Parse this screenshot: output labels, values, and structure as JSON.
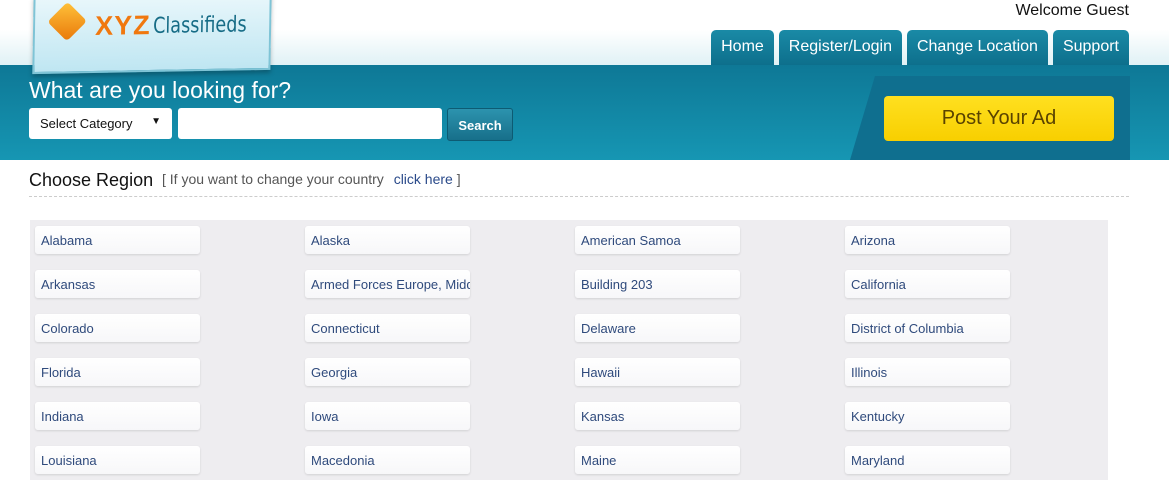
{
  "logo": {
    "text_bold": "XYZ",
    "text_rest": "Classifieds"
  },
  "header": {
    "welcome": "Welcome Guest",
    "nav": [
      "Home",
      "Register/Login",
      "Change Location",
      "Support"
    ]
  },
  "search": {
    "heading": "What are you looking for?",
    "category": "Select Category",
    "query": "",
    "button": "Search"
  },
  "post_ad": "Post Your Ad",
  "region": {
    "title": "Choose Region",
    "hint_open": "[ If you want to change your country",
    "hint_link": "click here",
    "hint_close": "]",
    "items": [
      "Alabama",
      "Alaska",
      "American Samoa",
      "Arizona",
      "Arkansas",
      "Armed Forces Europe, Middle East, & Canada",
      "Building 203",
      "California",
      "Colorado",
      "Connecticut",
      "Delaware",
      "District of Columbia",
      "Florida",
      "Georgia",
      "Hawaii",
      "Illinois",
      "Indiana",
      "Iowa",
      "Kansas",
      "Kentucky",
      "Louisiana",
      "Macedonia",
      "Maine",
      "Maryland"
    ]
  }
}
